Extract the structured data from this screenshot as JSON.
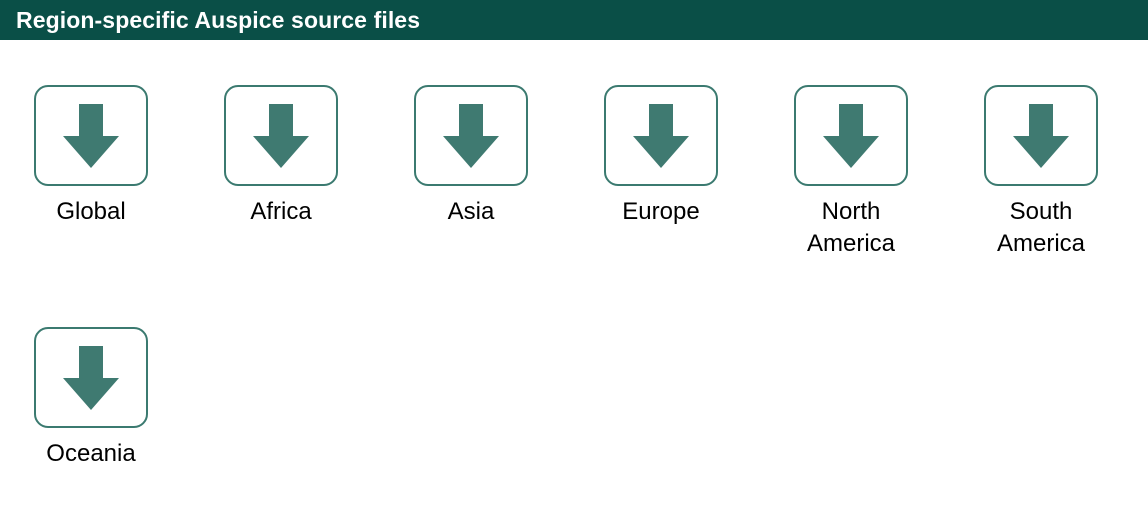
{
  "header": {
    "title": "Region-specific Auspice source files"
  },
  "colors": {
    "header_bg": "#0a4f47",
    "icon_fill": "#3f7a71",
    "icon_border": "#3b7a70"
  },
  "regions": [
    {
      "label": "Global",
      "icon": "download-arrow-icon"
    },
    {
      "label": "Africa",
      "icon": "download-arrow-icon"
    },
    {
      "label": "Asia",
      "icon": "download-arrow-icon"
    },
    {
      "label": "Europe",
      "icon": "download-arrow-icon"
    },
    {
      "label": "North America",
      "icon": "download-arrow-icon"
    },
    {
      "label": "South America",
      "icon": "download-arrow-icon"
    },
    {
      "label": "Oceania",
      "icon": "download-arrow-icon"
    }
  ]
}
